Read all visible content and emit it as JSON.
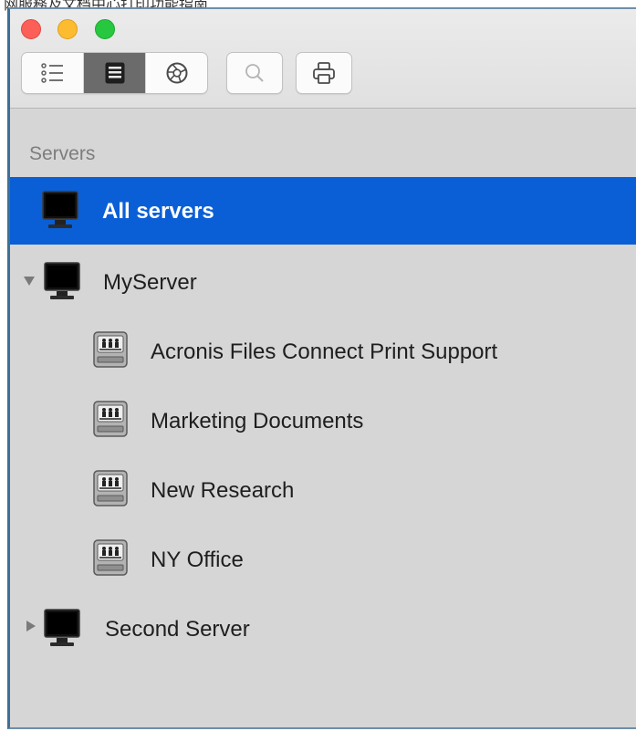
{
  "page_top_text": "网服務及文档中心打印功能指南",
  "toolbar": {
    "list_view": "list-view-icon",
    "server_view": "server-view-icon",
    "network_view": "network-view-icon",
    "search": "search-icon",
    "print": "print-icon"
  },
  "sidebar": {
    "section_header": "Servers",
    "all_servers": "All servers",
    "servers": [
      {
        "label": "MyServer",
        "expanded": true,
        "shares": [
          "Acronis Files Connect Print Support",
          "Marketing Documents",
          "New Research",
          "NY Office"
        ]
      },
      {
        "label": "Second Server",
        "expanded": false
      }
    ]
  },
  "colors": {
    "selection": "#0a5fd6",
    "sidebar_bg": "#d6d6d6",
    "close": "#fc5f57",
    "minimize": "#fdbc2f",
    "zoom": "#27c840"
  }
}
